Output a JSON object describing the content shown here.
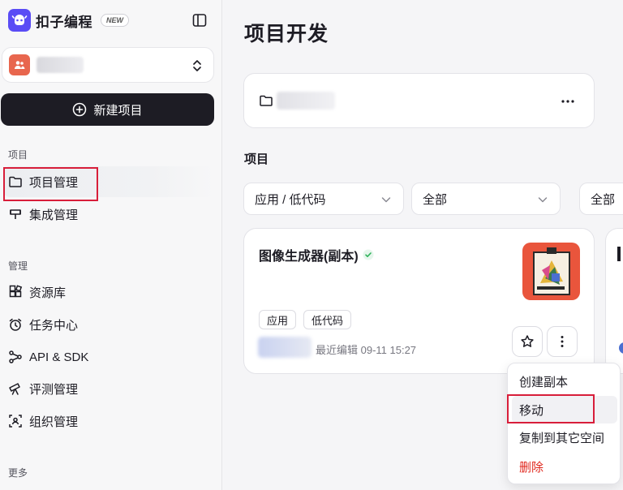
{
  "brand": {
    "name": "扣子编程",
    "badge": "NEW"
  },
  "sidebar": {
    "new_project_label": "新建项目",
    "sections": {
      "project": "项目",
      "manage": "管理",
      "more": "更多"
    },
    "project_items": [
      {
        "label": "项目管理",
        "icon": "folder-icon"
      },
      {
        "label": "集成管理",
        "icon": "integration-icon"
      }
    ],
    "manage_items": [
      {
        "label": "资源库",
        "icon": "grid-icon"
      },
      {
        "label": "任务中心",
        "icon": "alarm-icon"
      },
      {
        "label": "API & SDK",
        "icon": "api-icon"
      },
      {
        "label": "评测管理",
        "icon": "telescope-icon"
      },
      {
        "label": "组织管理",
        "icon": "org-icon"
      }
    ]
  },
  "main": {
    "title": "项目开发",
    "section_title": "项目",
    "filters": [
      {
        "value": "应用 / 低代码"
      },
      {
        "value": "全部"
      },
      {
        "value": "全部"
      }
    ],
    "project": {
      "name": "图像生成器(副本)",
      "tags": [
        "应用",
        "低代码"
      ],
      "edited": "最近编辑 09-11 15:27"
    }
  },
  "context_menu": {
    "items": [
      {
        "label": "创建副本"
      },
      {
        "label": "移动"
      },
      {
        "label": "复制到其它空间"
      },
      {
        "label": "删除"
      }
    ]
  },
  "colors": {
    "brand": "#5a4cf5",
    "dark_button": "#1d1c24",
    "highlight_box": "#d81e3a",
    "danger": "#e0281e",
    "verified": "#2fb35a",
    "thumb_bg": "#e9553c"
  }
}
